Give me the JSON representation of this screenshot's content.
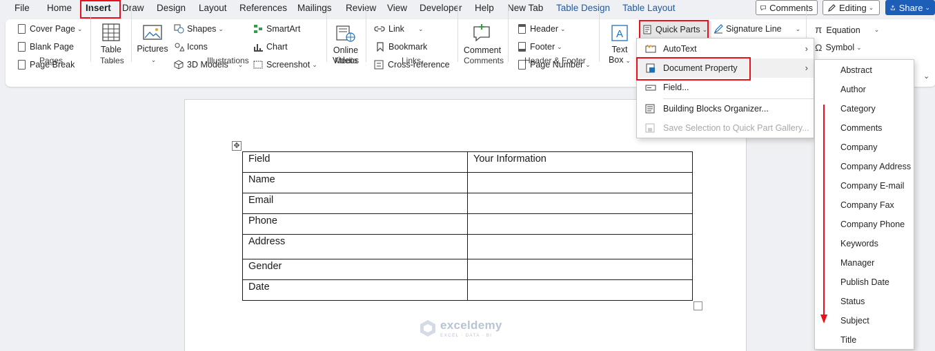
{
  "menu_tabs": [
    "File",
    "Home",
    "Insert",
    "Draw",
    "Design",
    "Layout",
    "References",
    "Mailings",
    "Review",
    "View",
    "Developer",
    "Help",
    "New Tab",
    "Table Design",
    "Table Layout"
  ],
  "top_right": {
    "comments": "Comments",
    "editing": "Editing",
    "share": "Share"
  },
  "ribbon": {
    "pages": {
      "cover_page": "Cover Page",
      "blank_page": "Blank Page",
      "page_break": "Page Break",
      "label": "Pages"
    },
    "tables": {
      "table": "Table",
      "label": "Tables"
    },
    "illustrations": {
      "pictures": "Pictures",
      "shapes": "Shapes",
      "icons": "Icons",
      "models": "3D Models",
      "smartart": "SmartArt",
      "chart": "Chart",
      "screenshot": "Screenshot",
      "label": "Illustrations"
    },
    "media": {
      "online_videos_1": "Online",
      "online_videos_2": "Videos",
      "label": "Media"
    },
    "links": {
      "link": "Link",
      "bookmark": "Bookmark",
      "cross_reference": "Cross-reference",
      "label": "Links"
    },
    "comments": {
      "comment": "Comment",
      "label": "Comments"
    },
    "header_footer": {
      "header": "Header",
      "footer": "Footer",
      "page_number": "Page Number",
      "label": "Header & Footer"
    },
    "text": {
      "text_box_1": "Text",
      "text_box_2": "Box",
      "quick_parts": "Quick Parts",
      "signature_line": "Signature Line"
    },
    "symbols": {
      "equation": "Equation",
      "symbol": "Symbol"
    }
  },
  "quick_parts_menu": [
    {
      "label": "AutoText",
      "submenu": true,
      "disabled": false
    },
    {
      "label": "Document Property",
      "submenu": true,
      "disabled": false
    },
    {
      "label": "Field...",
      "submenu": false,
      "disabled": false
    },
    {
      "label": "Building Blocks Organizer...",
      "submenu": false,
      "disabled": false
    },
    {
      "label": "Save Selection to Quick Part Gallery...",
      "submenu": false,
      "disabled": true
    }
  ],
  "document_properties": [
    "Abstract",
    "Author",
    "Category",
    "Comments",
    "Company",
    "Company Address",
    "Company E-mail",
    "Company Fax",
    "Company Phone",
    "Keywords",
    "Manager",
    "Publish Date",
    "Status",
    "Subject",
    "Title"
  ],
  "table": {
    "rows": [
      [
        "Field",
        "Your Information"
      ],
      [
        "Name",
        ""
      ],
      [
        "Email",
        ""
      ],
      [
        "Phone",
        ""
      ],
      [
        "Address",
        ""
      ],
      [
        "Gender",
        ""
      ],
      [
        "Date",
        ""
      ]
    ]
  },
  "watermark": {
    "name": "exceldemy",
    "tagline": "EXCEL · DATA · BI"
  },
  "colors": {
    "highlight": "#e8101a",
    "share": "#1d5fb8",
    "context_tab": "#1e5aa8"
  }
}
